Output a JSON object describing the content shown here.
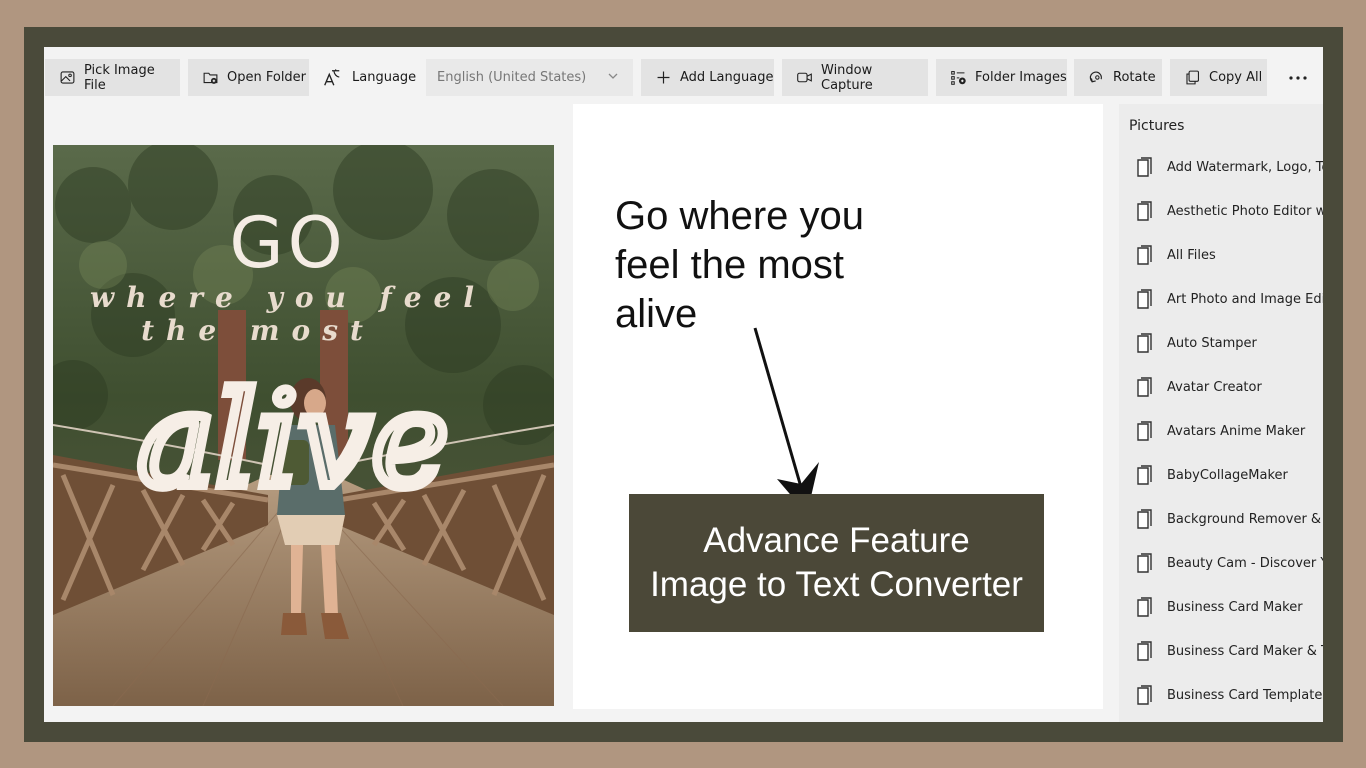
{
  "toolbar": {
    "pick_image": "Pick Image File",
    "open_folder": "Open Folder",
    "language_label": "Language",
    "language_value": "English (United States)",
    "add_language": "Add Language",
    "window_capture": "Window Capture",
    "folder_images": "Folder Images",
    "rotate": "Rotate",
    "copy_all": "Copy All",
    "more": "···"
  },
  "image": {
    "line_go": "GO",
    "line_where": "where you feel",
    "line_most": "the most",
    "line_alive": "alive"
  },
  "result": {
    "line1": "Go where you",
    "line2": "feel the most",
    "line3": "alive"
  },
  "promo": {
    "line1": "Advance Feature",
    "line2": "Image to Text Converter"
  },
  "sidebar": {
    "title": "Pictures",
    "items": [
      {
        "label": "Add Watermark, Logo, Text"
      },
      {
        "label": "Aesthetic Photo Editor wit..."
      },
      {
        "label": "All Files"
      },
      {
        "label": "Art Photo and Image Editor"
      },
      {
        "label": "Auto Stamper"
      },
      {
        "label": "Avatar Creator"
      },
      {
        "label": "Avatars Anime Maker"
      },
      {
        "label": "BabyCollageMaker"
      },
      {
        "label": "Background Remover & Pn"
      },
      {
        "label": "Beauty Cam - Discover You"
      },
      {
        "label": "Business Card Maker"
      },
      {
        "label": "Business Card Maker & Te..."
      },
      {
        "label": "Business Card Templates"
      }
    ]
  },
  "colors": {
    "outer_bg": "#b09680",
    "frame": "#4a4a3a",
    "promo_bg": "#4b4838",
    "button_bg": "#e3e3e3"
  }
}
